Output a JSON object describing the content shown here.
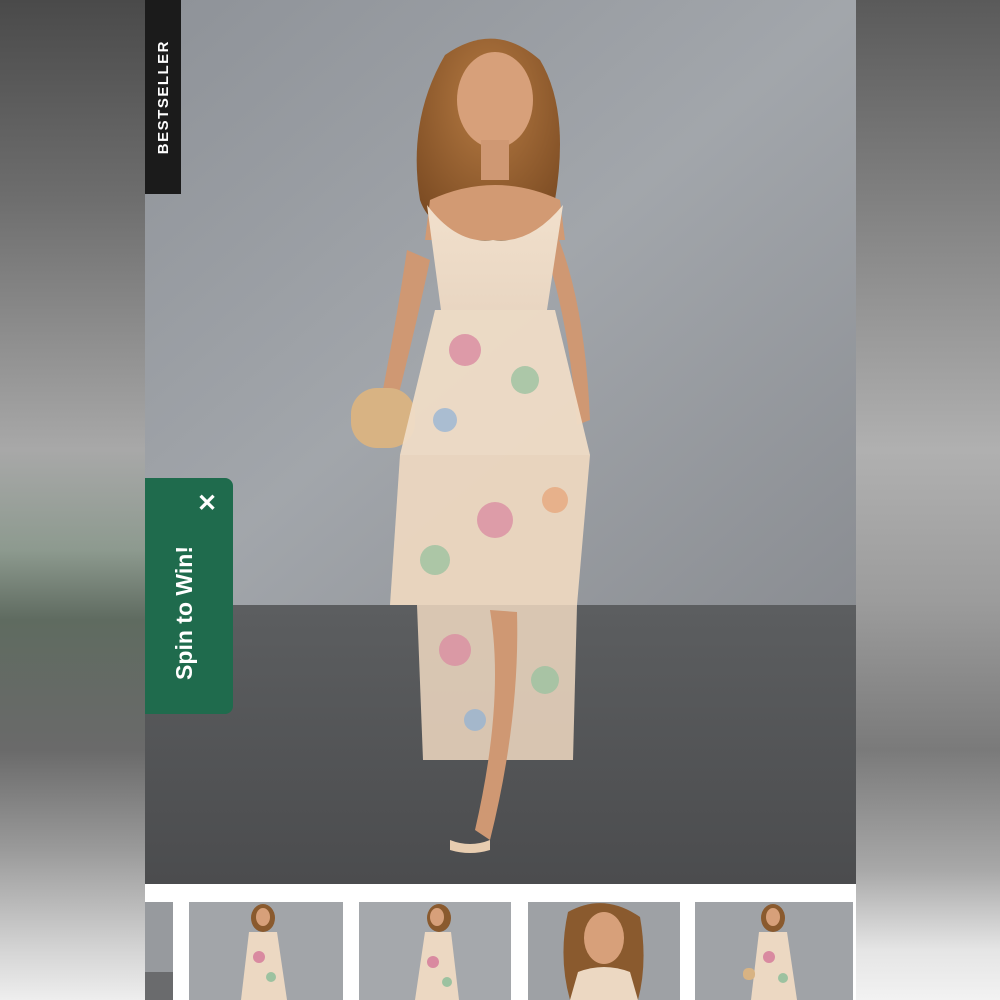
{
  "badge": {
    "label": "BESTSELLER"
  },
  "promo": {
    "label": "Spin to Win!",
    "close_icon": "close-icon",
    "color": "#1f6b4d"
  },
  "gallery": {
    "main_image": "floral-tiered-maxi-dress-model-photo",
    "thumbnails": [
      {
        "name": "thumbnail-partial"
      },
      {
        "name": "thumbnail-front-full"
      },
      {
        "name": "thumbnail-side-full"
      },
      {
        "name": "thumbnail-closeup"
      },
      {
        "name": "thumbnail-front-selected",
        "selected": true
      }
    ]
  }
}
